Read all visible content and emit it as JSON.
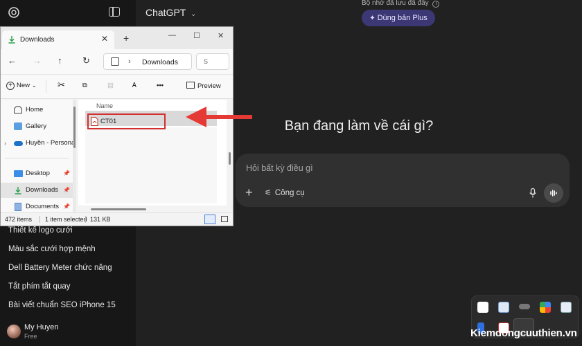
{
  "sidebar": {
    "chats": [
      "Thiết kế logo cưới",
      "Màu sắc cưới hợp mệnh",
      "Dell Battery Meter chức năng",
      "Tắt phím tắt quay",
      "Bài viết chuẩn SEO iPhone 15"
    ],
    "user": {
      "name": "My Huyen",
      "plan": "Free"
    }
  },
  "main": {
    "model": "ChatGPT",
    "memory_notice": "Bộ nhớ đã lưu đã đầy",
    "plus_button": "Dùng bản Plus",
    "headline": "Bạn đang làm về cái gì?",
    "composer": {
      "placeholder": "Hỏi bất kỳ điều gì",
      "tools_label": "Công cụ"
    }
  },
  "explorer": {
    "tab_title": "Downloads",
    "address": "Downloads",
    "search_hint": "S",
    "commands": {
      "new": "New",
      "preview": "Preview"
    },
    "nav_items": [
      {
        "label": "Home",
        "icon": "home-icon"
      },
      {
        "label": "Gallery",
        "icon": "gallery-icon"
      },
      {
        "label": "Huyền - Persona",
        "icon": "onedrive-cloud-icon"
      },
      {
        "label": "Desktop",
        "icon": "desktop-folder-icon"
      },
      {
        "label": "Downloads",
        "icon": "downloads-icon"
      },
      {
        "label": "Documents",
        "icon": "documents-icon"
      }
    ],
    "column_header": "Name",
    "file": {
      "name": "CT01",
      "icon": "pdf-file-icon"
    },
    "status": {
      "items": "472 items",
      "selected": "1 item selected",
      "size": "131 KB"
    }
  },
  "watermark": "Kiemdongcuuthien.vn",
  "colors": {
    "highlight": "#d32f2f",
    "arrow": "#e53935",
    "plus_button": "#3c3875"
  }
}
